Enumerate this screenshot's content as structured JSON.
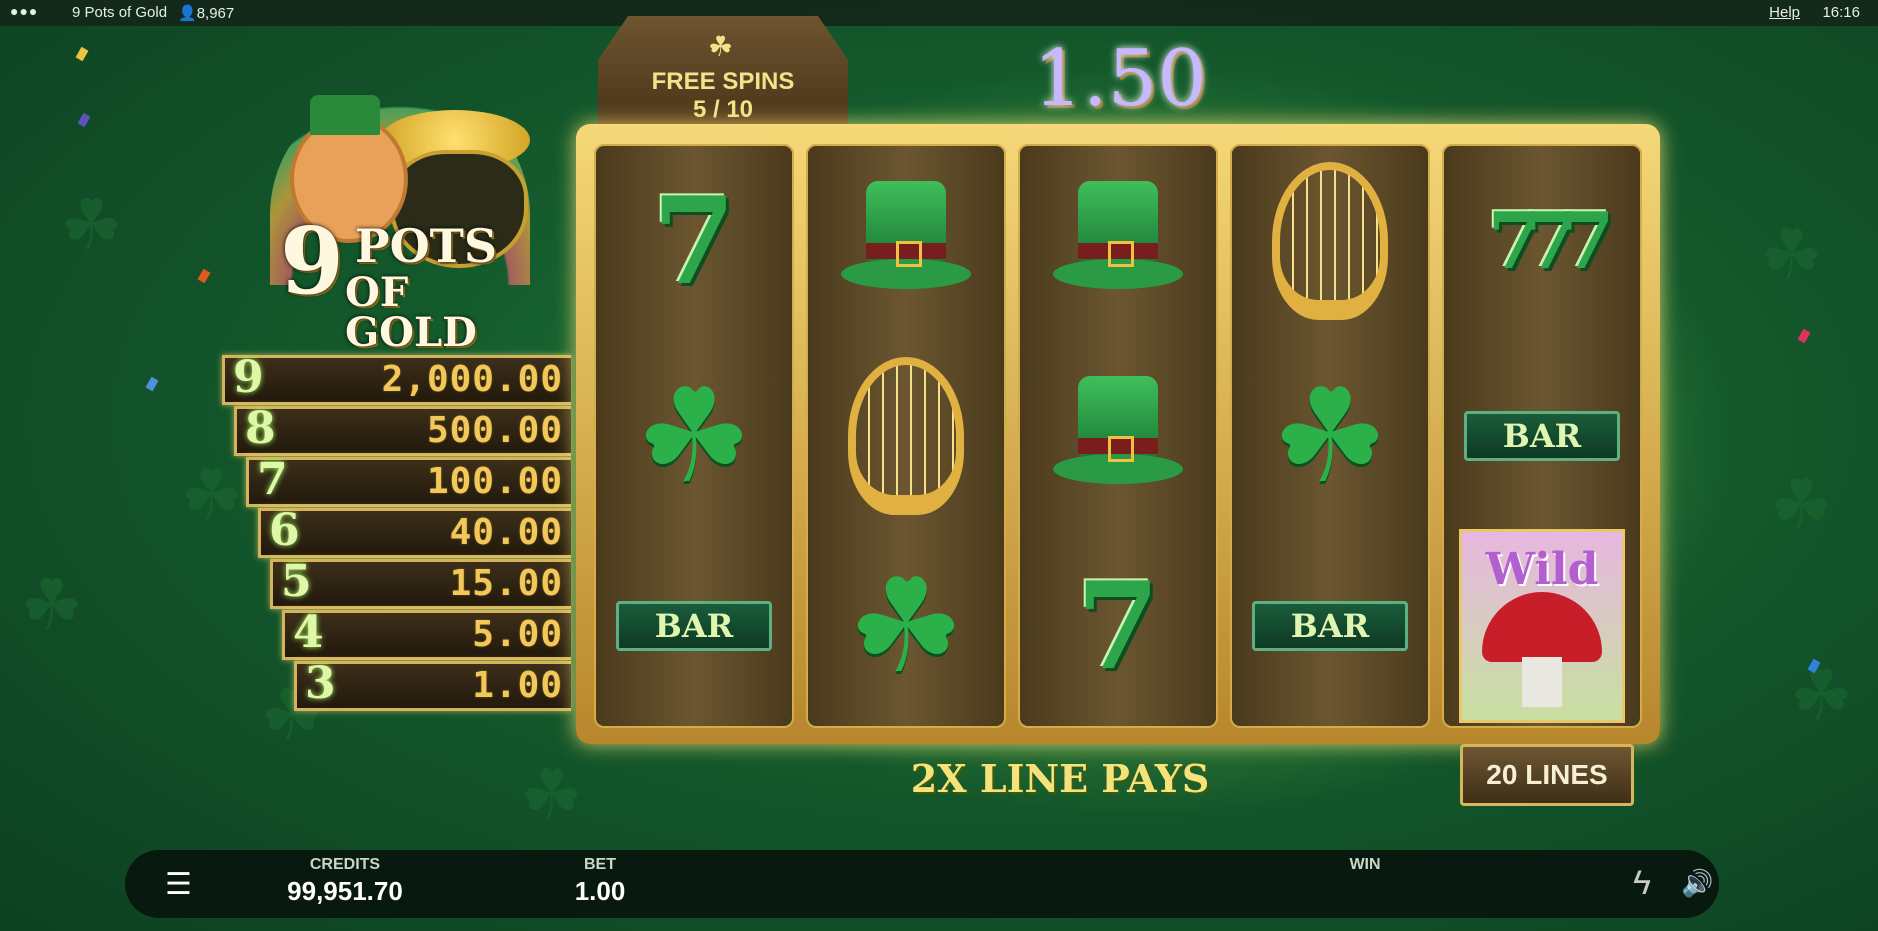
{
  "topbar": {
    "menu_icon": "more-dots-icon",
    "game_name": "9 Pots of Gold",
    "players": "8,967",
    "help": "Help",
    "time": "16:16"
  },
  "logo": {
    "number": "9",
    "line1": "POTS",
    "line2": "OF GOLD"
  },
  "paytable": [
    {
      "count": "9",
      "amount": "2,000.00"
    },
    {
      "count": "8",
      "amount": "500.00"
    },
    {
      "count": "7",
      "amount": "100.00"
    },
    {
      "count": "6",
      "amount": "40.00"
    },
    {
      "count": "5",
      "amount": "15.00"
    },
    {
      "count": "4",
      "amount": "5.00"
    },
    {
      "count": "3",
      "amount": "1.00"
    }
  ],
  "free_spins": {
    "label": "FREE SPINS",
    "count": "5 / 10"
  },
  "win_display": "1.50",
  "reels": [
    [
      "seven",
      "shamrock",
      "bar"
    ],
    [
      "top-hat",
      "harp",
      "shamrock"
    ],
    [
      "top-hat",
      "top-hat",
      "seven"
    ],
    [
      "harp",
      "shamrock",
      "bar"
    ],
    [
      "triple-seven",
      "bar",
      "wild"
    ]
  ],
  "symbol_text": {
    "seven": "7",
    "triple_seven": "777",
    "bar": "BAR",
    "wild": "Wild"
  },
  "line_pays": "2X LINE PAYS",
  "lines": "20 LINES",
  "bottom": {
    "credits_label": "CREDITS",
    "credits_value": "99,951.70",
    "bet_label": "BET",
    "bet_value": "1.00",
    "win_label": "WIN",
    "menu_icon": "hamburger-menu-icon",
    "turbo_icon": "lightning-icon",
    "sound_icon": "speaker-icon"
  },
  "colors": {
    "background": "#145a2c",
    "gold": "#d6b35a",
    "accent_text": "#f6e27a"
  }
}
